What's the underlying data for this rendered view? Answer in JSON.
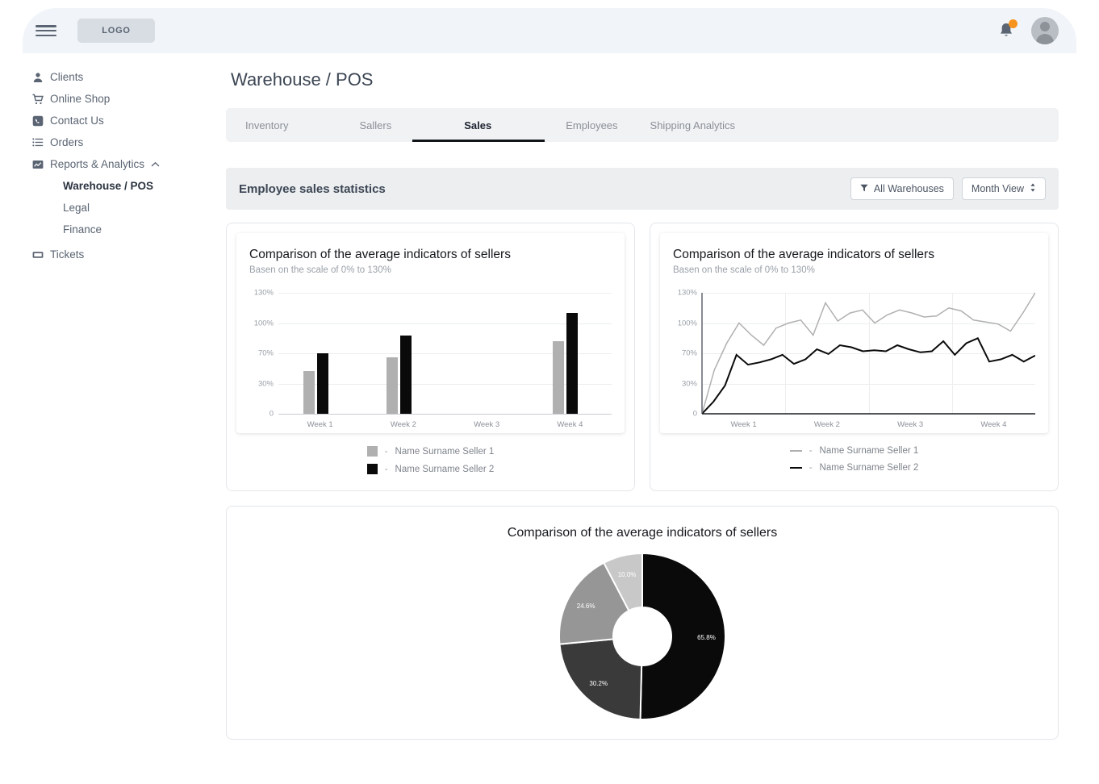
{
  "topbar": {
    "logo": "LOGO",
    "menu_icon": "hamburger-icon",
    "bell_icon": "notification-bell-icon",
    "avatar_icon": "user-avatar"
  },
  "sidebar": {
    "items": [
      {
        "label": "Clients",
        "icon": "person-icon"
      },
      {
        "label": "Online Shop",
        "icon": "shopping-cart-icon"
      },
      {
        "label": "Contact Us",
        "icon": "phone-icon"
      },
      {
        "label": "Orders",
        "icon": "list-icon"
      },
      {
        "label": "Reports & Analytics",
        "icon": "chart-line-icon",
        "expanded": true
      },
      {
        "label": "Tickets",
        "icon": "ticket-icon"
      }
    ],
    "subitems": [
      {
        "label": "Warehouse / POS",
        "active": true
      },
      {
        "label": "Legal",
        "active": false
      },
      {
        "label": "Finance",
        "active": false
      }
    ]
  },
  "main": {
    "page_title": "Warehouse / POS",
    "tabs": [
      {
        "label": "Inventory",
        "active": false
      },
      {
        "label": "Sallers",
        "active": false
      },
      {
        "label": "Sales",
        "active": true
      },
      {
        "label": "Employees",
        "active": false
      },
      {
        "label": "Shipping Analytics",
        "active": false
      }
    ],
    "section": {
      "title": "Employee sales statistics",
      "filter_button": "All Warehouses",
      "filter_icon": "filter-funnel-icon",
      "view_button": "Month View",
      "view_icon": "sort-updown-icon"
    }
  },
  "legends": {
    "seller1": "Name Surname Seller 1",
    "seller2": "Name Surname Seller 2",
    "dash": "-"
  },
  "colors": {
    "seller1": "#b0b0b0",
    "seller2": "#0a0a0a",
    "badge": "#f7941d",
    "grid": "#eceef0",
    "donut_black": "#0a0a0a",
    "donut_dark": "#3a3a3a",
    "donut_mid": "#969696",
    "donut_light": "#c8c8c8"
  },
  "chart_data": [
    {
      "type": "bar",
      "title": "Comparison of the average indicators of sellers",
      "subtitle": "Basen on the scale of 0% to 130%",
      "categories": [
        "Week 1",
        "Week 2",
        "Week 3",
        "Week 4"
      ],
      "yticks": [
        "0",
        "30%",
        "70%",
        "100%",
        "130%"
      ],
      "ylim": [
        0,
        130
      ],
      "ylabel": "",
      "xlabel": "",
      "grid": true,
      "legend_position": "bottom",
      "series": [
        {
          "name": "Name Surname Seller 1",
          "color": "#b0b0b0",
          "values": [
            47,
            65,
            null,
            82
          ]
        },
        {
          "name": "Name Surname Seller 2",
          "color": "#0a0a0a",
          "values": [
            70,
            88,
            null,
            110
          ]
        }
      ]
    },
    {
      "type": "line",
      "title": "Comparison of the average indicators of sellers",
      "subtitle": "Basen on the scale of 0% to 130%",
      "categories": [
        "Week 1",
        "Week 2",
        "Week 3",
        "Week 4"
      ],
      "yticks": [
        "0",
        "30%",
        "70%",
        "100%",
        "130%"
      ],
      "ylim": [
        0,
        130
      ],
      "grid": true,
      "legend_position": "bottom",
      "series": [
        {
          "name": "Name Surname Seller 1",
          "color": "#b0b0b0",
          "values": [
            0,
            48,
            80,
            100,
            88,
            78,
            95,
            100,
            103,
            88,
            120,
            102,
            110,
            113,
            100,
            108,
            113,
            110,
            106,
            107,
            115,
            112,
            103,
            101,
            99,
            92,
            110,
            130
          ]
        },
        {
          "name": "Name Surname Seller 2",
          "color": "#0a0a0a",
          "values": [
            0,
            12,
            28,
            68,
            55,
            58,
            62,
            68,
            56,
            62,
            74,
            69,
            78,
            76,
            72,
            73,
            72,
            78,
            74,
            71,
            72,
            82,
            68,
            80,
            85,
            59,
            62,
            68,
            59,
            67
          ]
        }
      ]
    },
    {
      "type": "pie",
      "title": "Comparison of the average indicators of sellers",
      "donut": true,
      "labels": [
        "65.8%",
        "30.2%",
        "24.6%",
        "10.0%"
      ],
      "values": [
        65.8,
        30.2,
        24.6,
        10.0
      ],
      "colors": [
        "#0a0a0a",
        "#3a3a3a",
        "#969696",
        "#c8c8c8"
      ]
    }
  ]
}
